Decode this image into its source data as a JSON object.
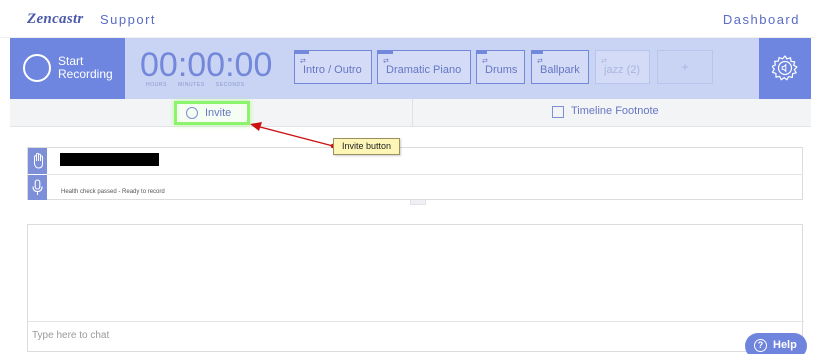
{
  "nav": {
    "logo": "Zencastr",
    "support": "Support",
    "dashboard": "Dashboard"
  },
  "recording": {
    "start_label": "Start Recording",
    "timer": "00:00:00",
    "units": [
      "HOURS",
      "MINUTES",
      "SECONDS"
    ],
    "loop_icon": "⇄"
  },
  "soundboard": [
    {
      "label": "Intro / Outro",
      "progress": 0.18
    },
    {
      "label": "Dramatic Piano",
      "progress": 0.16
    },
    {
      "label": "Drums",
      "progress": 0.22
    },
    {
      "label": "Ballpark",
      "progress": 0.2
    },
    {
      "label": "jazz (2)",
      "progress": 0
    }
  ],
  "soundboard_add": "+",
  "tabs": {
    "invite": "Invite",
    "footnote": "Timeline Footnote"
  },
  "annotation": {
    "callout": "Invite button"
  },
  "participant": {
    "status": "Health check passed - Ready to record"
  },
  "chat": {
    "placeholder": "Type here to chat"
  },
  "help": {
    "label": "Help",
    "icon": "?"
  },
  "colors": {
    "accent": "#6e86e0",
    "bar_bg": "#c9d3f3",
    "highlight": "#8cf36c",
    "callout": "#fdf6b7",
    "arrow": "#cc1111"
  }
}
